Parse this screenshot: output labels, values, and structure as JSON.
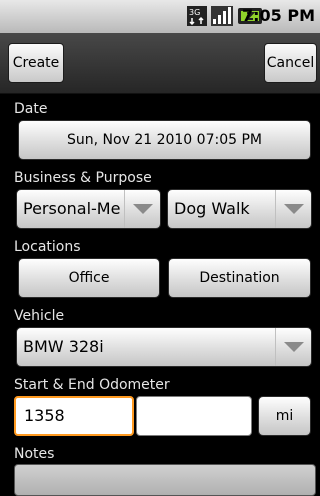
{
  "status_bar": {
    "network_label": "3G",
    "time": "7:05 PM",
    "icons": [
      "3g-icon",
      "signal-icon",
      "battery-charging-icon"
    ]
  },
  "toolbar": {
    "create_label": "Create",
    "cancel_label": "Cancel"
  },
  "form": {
    "date": {
      "label": "Date",
      "value": "Sun, Nov 21 2010 07:05 PM"
    },
    "business_purpose": {
      "label": "Business & Purpose",
      "business_value": "Personal-Me",
      "purpose_value": "Dog Walk"
    },
    "locations": {
      "label": "Locations",
      "from_label": "Office",
      "to_label": "Destination"
    },
    "vehicle": {
      "label": "Vehicle",
      "value": "BMW 328i"
    },
    "odometer": {
      "label": "Start & End Odometer",
      "start_value": "1358",
      "end_value": "",
      "unit_label": "mi"
    },
    "notes": {
      "label": "Notes",
      "value": ""
    }
  }
}
